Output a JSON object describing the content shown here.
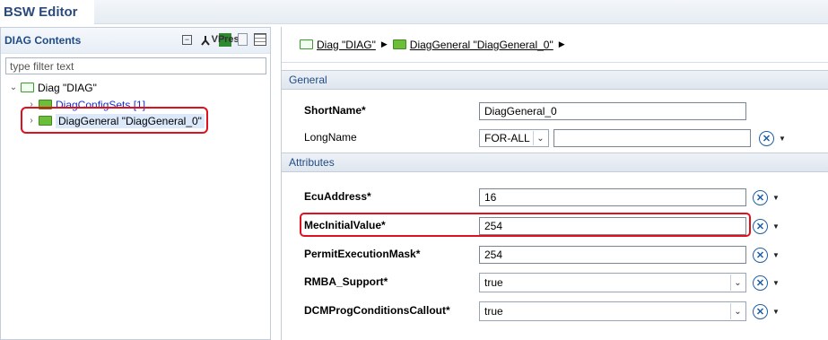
{
  "app": {
    "title": "BSW Editor"
  },
  "left_panel": {
    "title": "DIAG Contents",
    "toolbar_icons": [
      "collapse-all-icon",
      "link-icon",
      "vp-res-icon",
      "document-icon",
      "grid-icon"
    ],
    "vp_res_text_top": "VP",
    "vp_res_text_bottom": "res",
    "filter_placeholder": "type filter text",
    "tree": {
      "root": {
        "label": "Diag \"DIAG\"",
        "expanded": true
      },
      "children": [
        {
          "label": "DiagConfigSets [1]",
          "expanded": false,
          "link": true
        },
        {
          "label": "DiagGeneral \"DiagGeneral_0\"",
          "expanded": false,
          "selected": true,
          "highlighted": true
        }
      ]
    }
  },
  "breadcrumb": {
    "items": [
      {
        "label": "Diag \"DIAG\""
      },
      {
        "label": "DiagGeneral \"DiagGeneral_0\""
      }
    ],
    "separator": "▶"
  },
  "general": {
    "section_title": "General",
    "short_name": {
      "label": "ShortName*",
      "value": "DiagGeneral_0"
    },
    "long_name": {
      "label": "LongName",
      "language": "FOR-ALL",
      "value": ""
    }
  },
  "attributes": {
    "section_title": "Attributes",
    "ecu_address": {
      "label": "EcuAddress*",
      "value": "16"
    },
    "mec_initial_value": {
      "label": "MecInitialValue*",
      "value": "254",
      "highlighted": true
    },
    "permit_execution_mask": {
      "label": "PermitExecutionMask*",
      "value": "254"
    },
    "rmba_support": {
      "label": "RMBA_Support*",
      "value": "true"
    },
    "dcm_prog_conditions_callout": {
      "label": "DCMProgConditionsCallout*",
      "value": "true"
    }
  },
  "colors": {
    "title": "#2b4a7a",
    "section_text": "#1f4b86",
    "link": "#1530c8",
    "highlight": "#e0101c",
    "folder_green": "#6cbe3a",
    "selection": "#dbe9fb"
  }
}
